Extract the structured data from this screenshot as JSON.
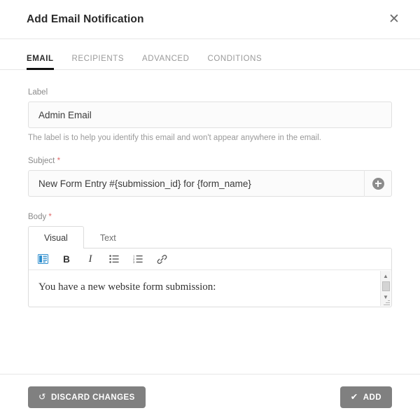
{
  "header": {
    "title": "Add Email Notification",
    "close_label": "✕"
  },
  "tabs": [
    {
      "label": "EMAIL",
      "active": true
    },
    {
      "label": "RECIPIENTS",
      "active": false
    },
    {
      "label": "ADVANCED",
      "active": false
    },
    {
      "label": "CONDITIONS",
      "active": false
    }
  ],
  "form": {
    "label_field": {
      "label": "Label",
      "value": "Admin Email",
      "placeholder": "",
      "help": "The label is to help you identify this email and won't appear anywhere in the email."
    },
    "subject_field": {
      "label": "Subject",
      "required_marker": "*",
      "value": "New Form Entry #{submission_id} for {form_name}",
      "placeholder": "",
      "addon_icon": "plus-circle-icon"
    },
    "body_field": {
      "label": "Body",
      "required_marker": "*",
      "editor_tabs": [
        {
          "label": "Visual",
          "active": true
        },
        {
          "label": "Text",
          "active": false
        }
      ],
      "toolbar": [
        {
          "name": "add-form-icon",
          "glyph": ""
        },
        {
          "name": "bold-icon",
          "glyph": "B"
        },
        {
          "name": "italic-icon",
          "glyph": "I"
        },
        {
          "name": "unordered-list-icon",
          "glyph": ""
        },
        {
          "name": "ordered-list-icon",
          "glyph": ""
        },
        {
          "name": "link-icon",
          "glyph": ""
        }
      ],
      "content": "You have a new website form submission:",
      "scroll_up": "▲",
      "scroll_down": "▼"
    }
  },
  "footer": {
    "discard_label": "DISCARD CHANGES",
    "discard_icon": "↺",
    "add_label": "ADD",
    "add_icon": "✔"
  },
  "colors": {
    "button_gray": "#808080",
    "accent_underline": "#111111",
    "required_red": "#e06a6a",
    "toolbar_blue": "#2e8ece"
  }
}
